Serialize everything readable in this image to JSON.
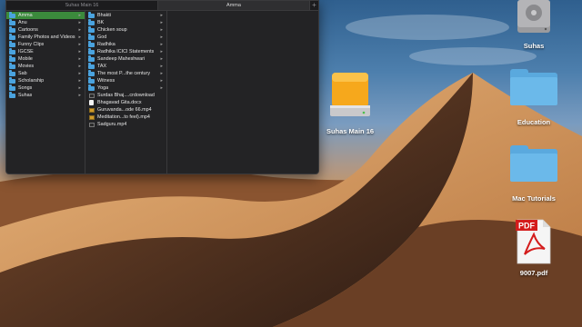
{
  "finder": {
    "tabs": [
      "Suhas Main 16",
      "Amma"
    ],
    "add_tab": "+",
    "column1": [
      {
        "label": "Amma",
        "selected": true
      },
      {
        "label": "Anu"
      },
      {
        "label": "Cartoons"
      },
      {
        "label": "Family Photos and Videos"
      },
      {
        "label": "Funny Clips"
      },
      {
        "label": "IGCSE"
      },
      {
        "label": "Mobile"
      },
      {
        "label": "Movies"
      },
      {
        "label": "Sab"
      },
      {
        "label": "Scholarship"
      },
      {
        "label": "Songs"
      },
      {
        "label": "Suhas"
      }
    ],
    "column2": [
      {
        "label": "Bhakti",
        "kind": "folder"
      },
      {
        "label": "BK",
        "kind": "folder"
      },
      {
        "label": "Chicken soup",
        "kind": "folder"
      },
      {
        "label": "God",
        "kind": "folder"
      },
      {
        "label": "Radhika",
        "kind": "folder"
      },
      {
        "label": "Radhika ICICI Statements",
        "kind": "folder"
      },
      {
        "label": "Sandeep Maheshwari",
        "kind": "folder"
      },
      {
        "label": "TAX",
        "kind": "folder"
      },
      {
        "label": "The most P...the century",
        "kind": "folder"
      },
      {
        "label": "Witness",
        "kind": "folder"
      },
      {
        "label": "Yoga",
        "kind": "folder"
      },
      {
        "label": "Surdas Bhaj....crdownload",
        "kind": "video"
      },
      {
        "label": "Bhagavad Gita.docx",
        "kind": "doc"
      },
      {
        "label": "Guruvanda...ode 66.mp4",
        "kind": "video-gold"
      },
      {
        "label": "Meditation...to feel).mp4",
        "kind": "video-gold"
      },
      {
        "label": "Sadguru.mp4",
        "kind": "video"
      }
    ]
  },
  "desktop": {
    "icons": [
      {
        "label": "Suhas Main 16"
      },
      {
        "label": "Suhas"
      },
      {
        "label": "Education"
      },
      {
        "label": "Mac Tutorials"
      },
      {
        "label": "9007.pdf"
      }
    ],
    "pdf_badge": "PDF"
  }
}
